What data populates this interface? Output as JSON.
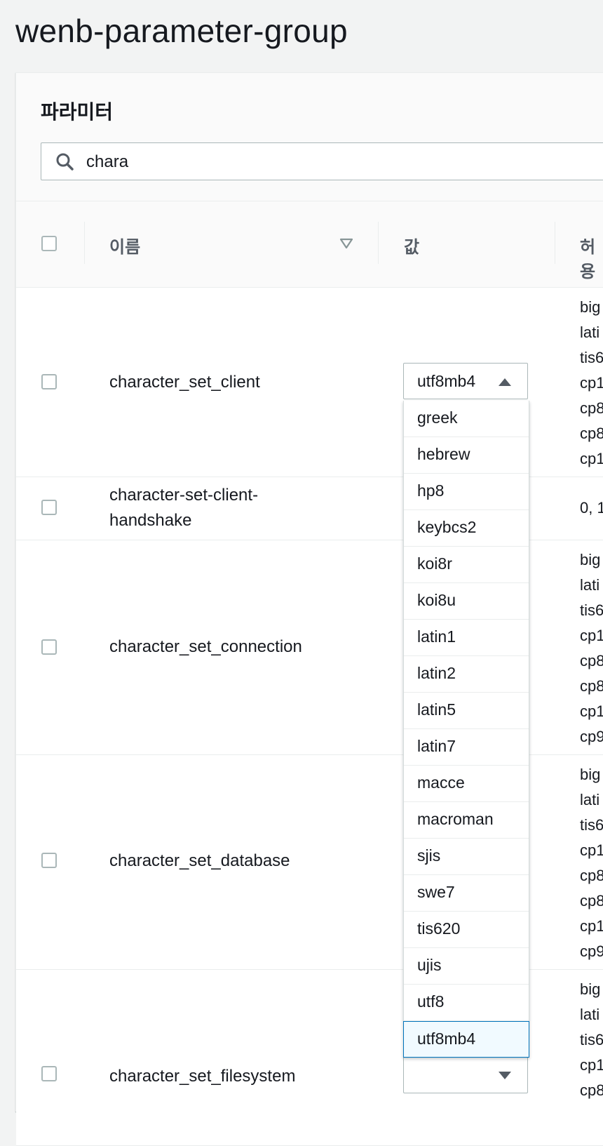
{
  "page": {
    "title": "wenb-parameter-group"
  },
  "section": {
    "title": "파라미터"
  },
  "search": {
    "value": "chara",
    "placeholder": ""
  },
  "table": {
    "headers": {
      "name": "이름",
      "value": "값",
      "allowed": "허용"
    },
    "rows": [
      {
        "name": "character_set_client",
        "value": "utf8mb4",
        "allowed": [
          "big",
          "lati",
          "tis6",
          "cp1",
          "cp8",
          "cp8",
          "cp1"
        ]
      },
      {
        "name": "character-set-client-\nhandshake",
        "name_lines": [
          "character-set-client-",
          "handshake"
        ],
        "allowed": [
          "0, 1"
        ]
      },
      {
        "name": "character_set_connection",
        "allowed": [
          "big",
          "lati",
          "tis6",
          "cp1",
          "cp8",
          "cp8",
          "cp1",
          "cp9"
        ]
      },
      {
        "name": "character_set_database",
        "allowed": [
          "big",
          "lati",
          "tis6",
          "cp1",
          "cp8",
          "cp8",
          "cp1",
          "cp9"
        ]
      },
      {
        "name": "character_set_filesystem",
        "value": "",
        "allowed": [
          "big",
          "lati",
          "tis6",
          "cp1",
          "cp8"
        ]
      }
    ]
  },
  "dropdown": {
    "options": [
      "greek",
      "hebrew",
      "hp8",
      "keybcs2",
      "koi8r",
      "koi8u",
      "latin1",
      "latin2",
      "latin5",
      "latin7",
      "macce",
      "macroman",
      "sjis",
      "swe7",
      "tis620",
      "ujis",
      "utf8",
      "utf8mb4"
    ],
    "selected": "utf8mb4"
  },
  "colors": {
    "accent": "#0073bb",
    "border": "#aab7b8",
    "header_bg": "#fafafa",
    "page_bg": "#f2f3f3"
  },
  "icons": {
    "search": "search-icon",
    "sort": "sort-down-icon",
    "caret_up": "caret-up-icon",
    "caret_down": "caret-down-icon"
  }
}
